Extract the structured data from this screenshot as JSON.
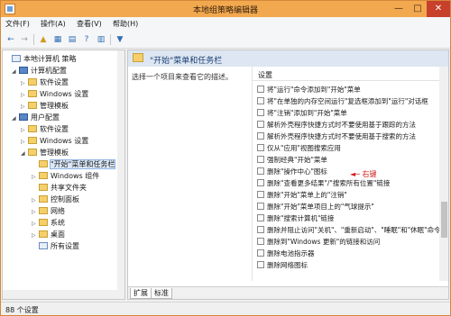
{
  "window": {
    "title": "本地组策略编辑器",
    "controls": {
      "minimize": "—",
      "maximize": "□",
      "close": "✕"
    }
  },
  "menu": [
    "文件(F)",
    "操作(A)",
    "查看(V)",
    "帮助(H)"
  ],
  "toolbar": {
    "icons": [
      "back-icon",
      "forward-icon",
      "up-folder-icon",
      "show-tree-icon",
      "properties-icon",
      "help-icon",
      "export-list-icon",
      "filter-icon"
    ],
    "glyphs": [
      "←",
      "→",
      "▲",
      "▦",
      "▤",
      "?",
      "▥",
      "▼"
    ]
  },
  "tree": {
    "items": [
      {
        "label": "本地计算机 策略",
        "expand": "",
        "icon": "policy"
      },
      {
        "label": "计算机配置",
        "expand": "◢",
        "icon": "computer"
      },
      {
        "label": "软件设置",
        "expand": "▷",
        "icon": "folder"
      },
      {
        "label": "Windows 设置",
        "expand": "▷",
        "icon": "folder"
      },
      {
        "label": "管理模板",
        "expand": "▷",
        "icon": "folder"
      },
      {
        "label": "用户配置",
        "expand": "◢",
        "icon": "computer"
      },
      {
        "label": "软件设置",
        "expand": "▷",
        "icon": "folder"
      },
      {
        "label": "Windows 设置",
        "expand": "▷",
        "icon": "folder"
      },
      {
        "label": "管理模板",
        "expand": "◢",
        "icon": "folder"
      },
      {
        "label": "\"开始\"菜单和任务栏",
        "expand": "",
        "icon": "folder"
      },
      {
        "label": "Windows 组件",
        "expand": "▷",
        "icon": "folder"
      },
      {
        "label": "共享文件夹",
        "expand": "",
        "icon": "folder"
      },
      {
        "label": "控制面板",
        "expand": "▷",
        "icon": "folder"
      },
      {
        "label": "网络",
        "expand": "▷",
        "icon": "folder"
      },
      {
        "label": "系统",
        "expand": "▷",
        "icon": "folder"
      },
      {
        "label": "桌面",
        "expand": "▷",
        "icon": "folder"
      },
      {
        "label": "所有设置",
        "expand": "",
        "icon": "policy"
      }
    ]
  },
  "right": {
    "header": "\"开始\"菜单和任务栏",
    "description": "选择一个项目来查看它的描述。",
    "column": "设置",
    "settings": [
      "将\"运行\"命令添加到\"开始\"菜单",
      "将\"在单独的内存空间运行\"复选框添加到\"运行\"对话框",
      "将\"注销\"添加到\"开始\"菜单",
      "解析外壳程序快捷方式时不要使用基于跟踪的方法",
      "解析外壳程序快捷方式时不要使用基于搜索的方法",
      "仅从\"应用\"视图搜索应用",
      "强制经典\"开始\"菜单",
      "删除\"操作中心\"图标",
      "删除\"查看更多结果\"/\"搜索所有位置\"链接",
      "删除\"开始\"菜单上的\"注销\"",
      "删除\"开始\"菜单项目上的\"气球提示\"",
      "删除\"搜索计算机\"链接",
      "删除并阻止访问\"关机\"、\"重新启动\"、\"睡眠\"和\"休眠\"命令",
      "删除到\"Windows 更新\"的链接和访问",
      "删除电池指示器",
      "删除网络图标"
    ],
    "annotation": "◄─ 右键",
    "tabs": [
      "扩展",
      "标准"
    ]
  },
  "status": {
    "text": "88 个设置"
  }
}
